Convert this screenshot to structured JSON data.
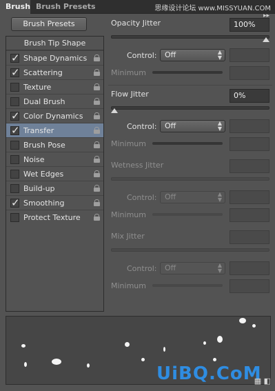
{
  "tabs": {
    "brush": "Brush",
    "presets": "Brush Presets"
  },
  "watermark": "思缘设计论坛 www.MISSYUAN.COM",
  "buttons": {
    "brush_presets": "Brush Presets"
  },
  "left": {
    "tip_shape": "Brush Tip Shape",
    "options": [
      {
        "label": "Shape Dynamics",
        "checked": true,
        "selected": false
      },
      {
        "label": "Scattering",
        "checked": true,
        "selected": false
      },
      {
        "label": "Texture",
        "checked": false,
        "selected": false
      },
      {
        "label": "Dual Brush",
        "checked": false,
        "selected": false
      },
      {
        "label": "Color Dynamics",
        "checked": true,
        "selected": false
      },
      {
        "label": "Transfer",
        "checked": true,
        "selected": true
      },
      {
        "label": "Brush Pose",
        "checked": false,
        "selected": false
      },
      {
        "label": "Noise",
        "checked": false,
        "selected": false
      },
      {
        "label": "Wet Edges",
        "checked": false,
        "selected": false
      },
      {
        "label": "Build-up",
        "checked": false,
        "selected": false
      },
      {
        "label": "Smoothing",
        "checked": true,
        "selected": false
      },
      {
        "label": "Protect Texture",
        "checked": false,
        "selected": false
      }
    ]
  },
  "right": {
    "opacity": {
      "label": "Opacity Jitter",
      "value": "100%",
      "control_label": "Control:",
      "control_value": "Off",
      "minimum_label": "Minimum",
      "slider": 1.0
    },
    "flow": {
      "label": "Flow Jitter",
      "value": "0%",
      "control_label": "Control:",
      "control_value": "Off",
      "minimum_label": "Minimum",
      "slider": 0.0
    },
    "wetness": {
      "label": "Wetness Jitter",
      "control_label": "Control:",
      "control_value": "Off",
      "minimum_label": "Minimum"
    },
    "mix": {
      "label": "Mix Jitter",
      "control_label": "Control:",
      "control_value": "Off",
      "minimum_label": "Minimum"
    }
  },
  "logo": "UiBQ.CoM",
  "colors": {
    "selected_row": "#6f8199",
    "logo": "#2f8de2"
  }
}
